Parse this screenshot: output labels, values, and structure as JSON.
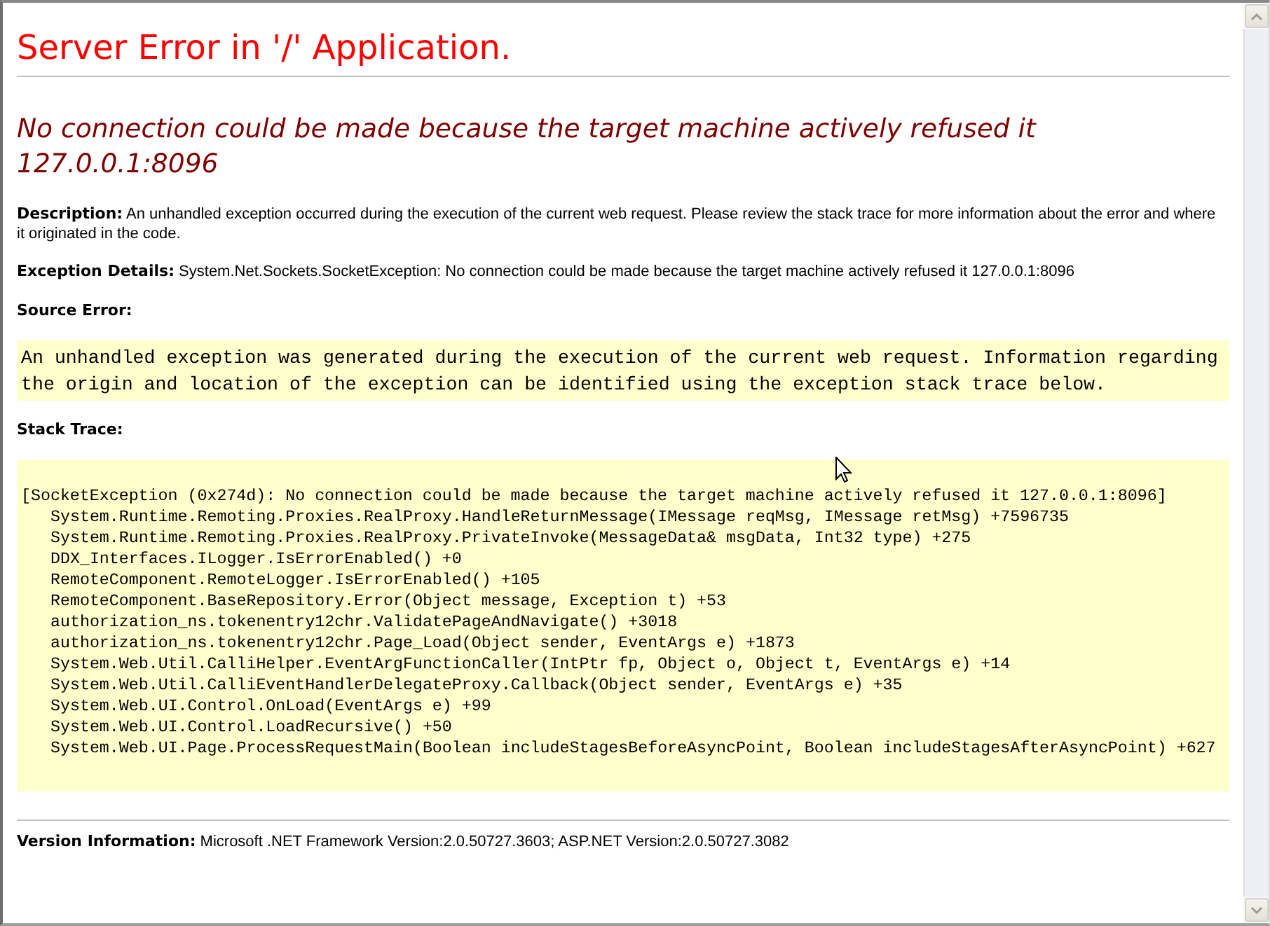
{
  "title": "Server Error in '/' Application.",
  "error_message": "No connection could be made because the target machine actively refused it 127.0.0.1:8096",
  "description": {
    "label": "Description:",
    "text": "An unhandled exception occurred during the execution of the current web request. Please review the stack trace for more information about the error and where it originated in the code."
  },
  "exception_details": {
    "label": "Exception Details:",
    "text": "System.Net.Sockets.SocketException: No connection could be made because the target machine actively refused it 127.0.0.1:8096"
  },
  "source_error": {
    "heading": "Source Error:",
    "lines": [
      "An unhandled exception was generated during the execution of the current web request. Information regarding",
      "the origin and location of the exception can be identified using the exception stack trace below."
    ]
  },
  "stack_trace": {
    "heading": "Stack Trace:",
    "exception": "[SocketException (0x274d): No connection could be made because the target machine actively refused it 127.0.0.1:8096]",
    "frames": [
      "System.Runtime.Remoting.Proxies.RealProxy.HandleReturnMessage(IMessage reqMsg, IMessage retMsg) +7596735",
      "System.Runtime.Remoting.Proxies.RealProxy.PrivateInvoke(MessageData& msgData, Int32 type) +275",
      "DDX_Interfaces.ILogger.IsErrorEnabled() +0",
      "RemoteComponent.RemoteLogger.IsErrorEnabled() +105",
      "RemoteComponent.BaseRepository.Error(Object message, Exception t) +53",
      "authorization_ns.tokenentry12chr.ValidatePageAndNavigate() +3018",
      "authorization_ns.tokenentry12chr.Page_Load(Object sender, EventArgs e) +1873",
      "System.Web.Util.CalliHelper.EventArgFunctionCaller(IntPtr fp, Object o, Object t, EventArgs e) +14",
      "System.Web.Util.CalliEventHandlerDelegateProxy.Callback(Object sender, EventArgs e) +35",
      "System.Web.UI.Control.OnLoad(EventArgs e) +99",
      "System.Web.UI.Control.LoadRecursive() +50",
      "System.Web.UI.Page.ProcessRequestMain(Boolean includeStagesBeforeAsyncPoint, Boolean includeStagesAfterAsyncPoint) +627"
    ]
  },
  "version_information": {
    "label": "Version Information:",
    "text": "Microsoft .NET Framework Version:2.0.50727.3603; ASP.NET Version:2.0.50727.3082"
  }
}
